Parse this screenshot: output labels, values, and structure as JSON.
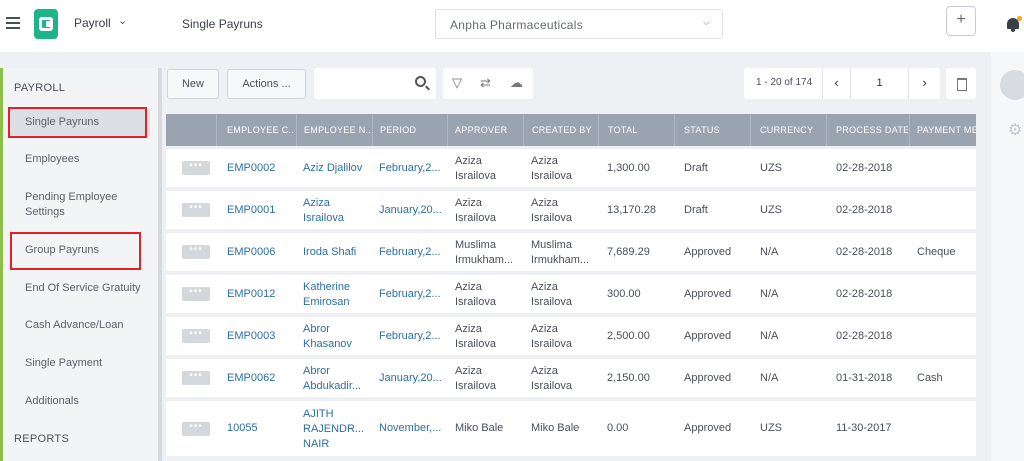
{
  "header": {
    "app_name": "Payroll",
    "page_title": "Single Payruns",
    "company": "Anpha Pharmaceuticals",
    "plus_label": "+"
  },
  "sidebar": {
    "section_payroll": "PAYROLL",
    "items": [
      {
        "label": "Single Payruns"
      },
      {
        "label": "Employees"
      },
      {
        "label": "Pending Employee Settings"
      },
      {
        "label": "Group Payruns"
      },
      {
        "label": "End Of Service Gratuity"
      },
      {
        "label": "Cash Advance/Loan"
      },
      {
        "label": "Single Payment"
      },
      {
        "label": "Additionals"
      }
    ],
    "section_reports": "REPORTS"
  },
  "toolbar": {
    "new_label": "New",
    "actions_label": "Actions ...",
    "search_value": "",
    "pager_range": "1 - 20 of 174",
    "current_page": "1"
  },
  "table": {
    "columns": [
      "EMPLOYEE C...",
      "EMPLOYEE N...",
      "PERIOD",
      "APPROVER",
      "CREATED BY",
      "TOTAL",
      "STATUS",
      "CURRENCY",
      "PROCESS DATE",
      "PAYMENT MET"
    ],
    "row_button": "•••",
    "rows": [
      {
        "code": "EMP0002",
        "name": [
          "Aziz Djalilov"
        ],
        "period": "February,2...",
        "approver": [
          "Aziza",
          "Israilova"
        ],
        "created_by": [
          "Aziza",
          "Israilova"
        ],
        "total": "1,300.00",
        "status": "Draft",
        "currency": "UZS",
        "process_date": "02-28-2018",
        "payment": ""
      },
      {
        "code": "EMP0001",
        "name": [
          "Aziza",
          "Israilova"
        ],
        "period": "January,20...",
        "approver": [
          "Aziza",
          "Israilova"
        ],
        "created_by": [
          "Aziza",
          "Israilova"
        ],
        "total": "13,170.28",
        "status": "Draft",
        "currency": "UZS",
        "process_date": "02-28-2018",
        "payment": ""
      },
      {
        "code": "EMP0006",
        "name": [
          "Iroda Shafi"
        ],
        "period": "February,2...",
        "approver": [
          "Muslima",
          "Irmukham..."
        ],
        "created_by": [
          "Muslima",
          "Irmukham..."
        ],
        "total": "7,689.29",
        "status": "Approved",
        "currency": "N/A",
        "process_date": "02-28-2018",
        "payment": "Cheque"
      },
      {
        "code": "EMP0012",
        "name": [
          "Katherine",
          "Emirosan"
        ],
        "period": "February,2...",
        "approver": [
          "Aziza",
          "Israilova"
        ],
        "created_by": [
          "Aziza",
          "Israilova"
        ],
        "total": "300.00",
        "status": "Approved",
        "currency": "N/A",
        "process_date": "02-28-2018",
        "payment": ""
      },
      {
        "code": "EMP0003",
        "name": [
          "Abror",
          "Khasanov"
        ],
        "period": "February,2...",
        "approver": [
          "Aziza",
          "Israilova"
        ],
        "created_by": [
          "Aziza",
          "Israilova"
        ],
        "total": "2,500.00",
        "status": "Approved",
        "currency": "N/A",
        "process_date": "02-28-2018",
        "payment": ""
      },
      {
        "code": "EMP0062",
        "name": [
          "Abror",
          "Abdukadir..."
        ],
        "period": "January,20...",
        "approver": [
          "Aziza",
          "Israilova"
        ],
        "created_by": [
          "Aziza",
          "Israilova"
        ],
        "total": "2,150.00",
        "status": "Approved",
        "currency": "N/A",
        "process_date": "01-31-2018",
        "payment": "Cash"
      },
      {
        "code": "10055",
        "name": [
          "AJITH",
          "RAJENDR...",
          "NAIR"
        ],
        "period": "November,...",
        "approver": [
          "Miko Bale"
        ],
        "created_by": [
          "Miko Bale"
        ],
        "total": "0.00",
        "status": "Approved",
        "currency": "UZS",
        "process_date": "11-30-2017",
        "payment": ""
      }
    ]
  },
  "colors": {
    "accent_green": "#8cc04a",
    "table_header": "#9aa3b0",
    "link_blue": "#2b6fa8",
    "highlight_red": "#e3202a"
  }
}
